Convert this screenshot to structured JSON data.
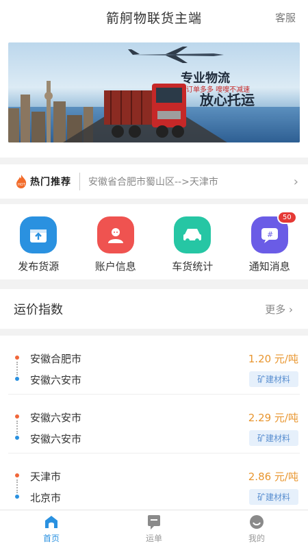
{
  "header": {
    "title": "箭舸物联货主端",
    "service": "客服"
  },
  "banner": {
    "slogan_main": "专业物流",
    "slogan_sub": "订单多多 嗖嗖不减速",
    "slogan_second": "放心托运"
  },
  "hot": {
    "badge": "热门推荐",
    "route": "安徽省合肥市蜀山区-->天津市",
    "arrow": "›"
  },
  "grid": [
    {
      "label": "发布货源",
      "icon": "publish-icon",
      "color": "#2a91e0"
    },
    {
      "label": "账户信息",
      "icon": "account-icon",
      "color": "#ef5350"
    },
    {
      "label": "车货统计",
      "icon": "truck-stats-icon",
      "color": "#26c6a4"
    },
    {
      "label": "通知消息",
      "icon": "message-icon",
      "color": "#6a5ce6",
      "badge": "50"
    }
  ],
  "index": {
    "title": "运价指数",
    "more": "更多 ›"
  },
  "rows": [
    {
      "from": "安徽合肥市",
      "to": "安徽六安市",
      "price": "1.20 元/吨",
      "tag": "矿建材料"
    },
    {
      "from": "安徽六安市",
      "to": "安徽六安市",
      "price": "2.29 元/吨",
      "tag": "矿建材料"
    },
    {
      "from": "天津市",
      "to": "北京市",
      "price": "2.86 元/吨",
      "tag": "矿建材料"
    }
  ],
  "tabs": [
    {
      "label": "首页",
      "icon": "home-icon",
      "active": true
    },
    {
      "label": "运单",
      "icon": "waybill-icon",
      "active": false
    },
    {
      "label": "我的",
      "icon": "profile-icon",
      "active": false
    }
  ],
  "colors": {
    "accent": "#2a91e0",
    "price": "#e8952e",
    "tag_text": "#5a8fd0"
  }
}
